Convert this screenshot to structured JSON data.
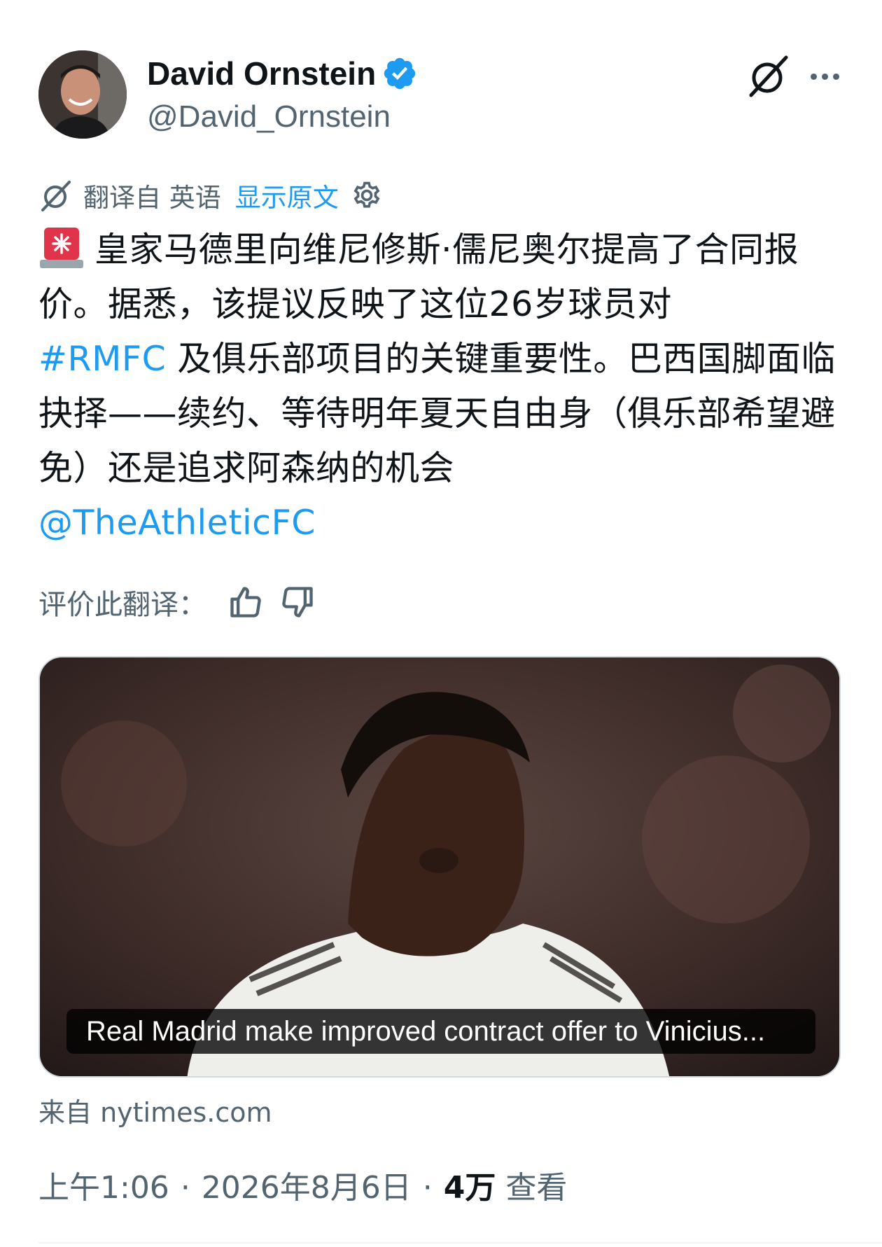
{
  "author": {
    "name": "David Ornstein",
    "handle": "@David_Ornstein",
    "verified": true
  },
  "icons": {
    "grok": "grok-icon",
    "more": "more-icon",
    "translate": "translate-icon",
    "settings": "gear-icon",
    "siren": "siren-emoji",
    "thumbs_up": "thumbs-up-icon",
    "thumbs_down": "thumbs-down-icon"
  },
  "translation": {
    "translated_from": "翻译自 英语",
    "show_original": "显示原文"
  },
  "tweet": {
    "text_part1": "皇家马德里向维尼修斯·儒尼奥尔提高了合同报价。据悉，该提议反映了这位26岁球员对",
    "hashtag": "#RMFC",
    "text_part2": " 及俱乐部项目的关键重要性。巴西国脚面临抉择——续约、等待明年夏天自由身（俱乐部希望避免）还是追求阿森纳的机会",
    "mention": "@TheAthleticFC"
  },
  "rate": {
    "label": "评价此翻译："
  },
  "card": {
    "caption": "Real Madrid make improved contract offer to Vinicius...",
    "source": "来自 nytimes.com"
  },
  "meta": {
    "time": "上午1:06",
    "date": "2026年8月6日",
    "views_count": "4万",
    "views_label": "查看"
  },
  "colors": {
    "link": "#1d9bf0",
    "secondary": "#536471",
    "primary_text": "#0f1419",
    "verified": "#1d9bf0",
    "siren_red": "#e0344a"
  }
}
